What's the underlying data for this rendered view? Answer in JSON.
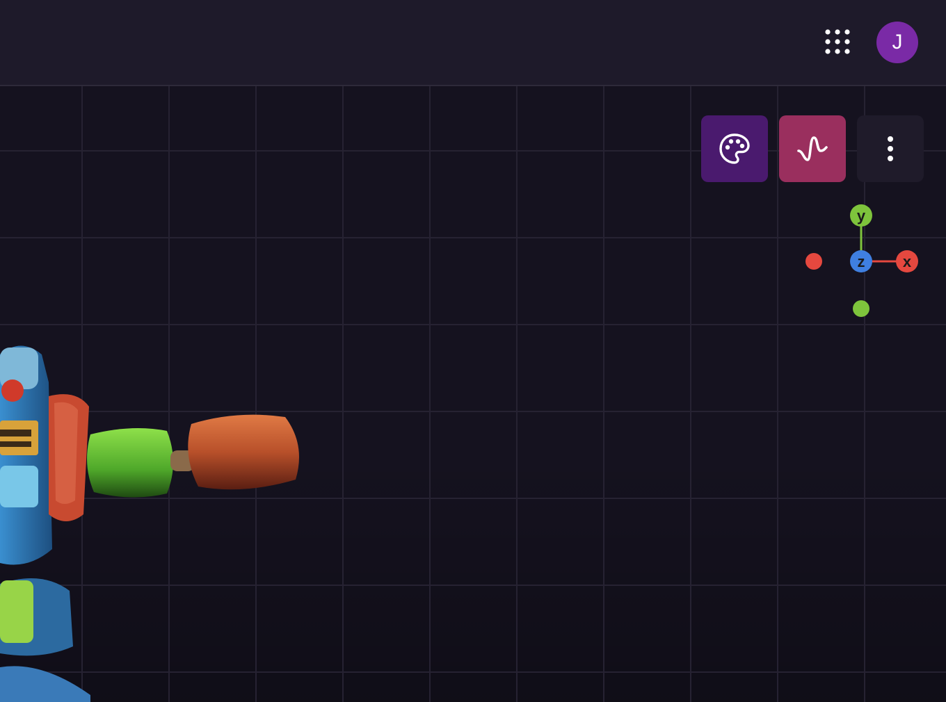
{
  "header": {
    "apps_icon": "grid-dots-icon",
    "avatar_letter": "J",
    "avatar_color": "#7a2aa6"
  },
  "toolbar": {
    "buttons": [
      {
        "icon": "palette-icon",
        "color": "#4a1a6e"
      },
      {
        "icon": "wave-icon",
        "color": "#9a2f5e"
      },
      {
        "icon": "more-vertical-icon",
        "color": "#1f1b2a"
      }
    ]
  },
  "gizmo": {
    "x_label": "x",
    "y_label": "y",
    "z_label": "z",
    "x_color": "#e5483f",
    "y_color": "#7ec43c",
    "z_color": "#3f7fe0"
  },
  "colors": {
    "background": "#15121f",
    "topbar": "#1e1a2a",
    "grid_line": "#2a2636"
  }
}
